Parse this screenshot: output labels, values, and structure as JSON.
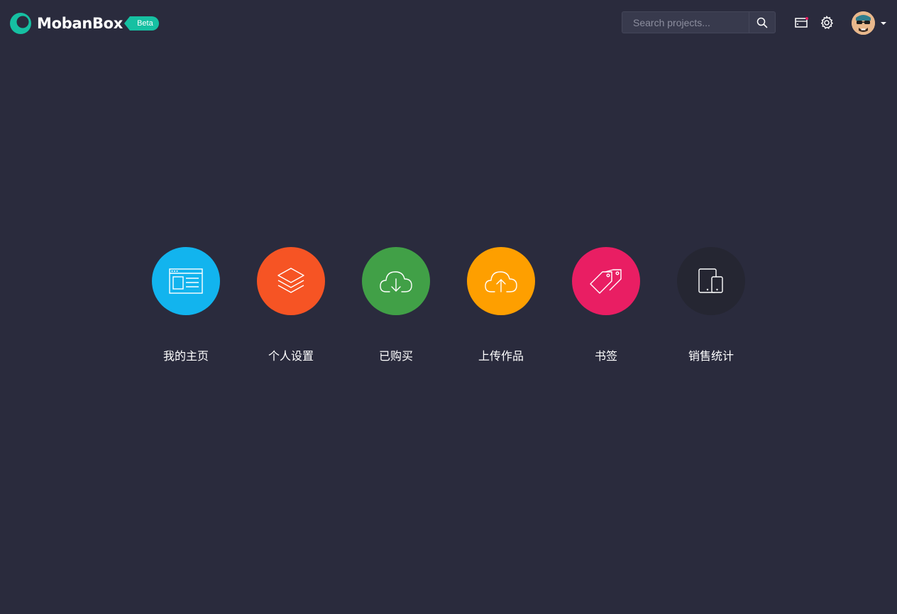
{
  "header": {
    "brand_name": "MobanBox",
    "badge": "Beta",
    "search_placeholder": "Search projects...",
    "icons": {
      "logo": "logo-mark-icon",
      "search": "search-icon",
      "folder": "folder-icon",
      "settings": "gear-icon",
      "avatar": "avatar",
      "dropdown": "caret-down-icon"
    }
  },
  "tiles": [
    {
      "label": "我的主页",
      "icon": "browser-window-icon",
      "color": "#12b4ee"
    },
    {
      "label": "个人设置",
      "icon": "layers-icon",
      "color": "#f65424"
    },
    {
      "label": "已购买",
      "icon": "cloud-download-icon",
      "color": "#41a047"
    },
    {
      "label": "上传作品",
      "icon": "cloud-upload-icon",
      "color": "#fe9f00"
    },
    {
      "label": "书签",
      "icon": "tags-icon",
      "color": "#e91e63"
    },
    {
      "label": "销售统计",
      "icon": "devices-icon",
      "color": "#252632"
    }
  ],
  "colors": {
    "background": "#2a2b3d",
    "accent": "#16c0a2"
  }
}
